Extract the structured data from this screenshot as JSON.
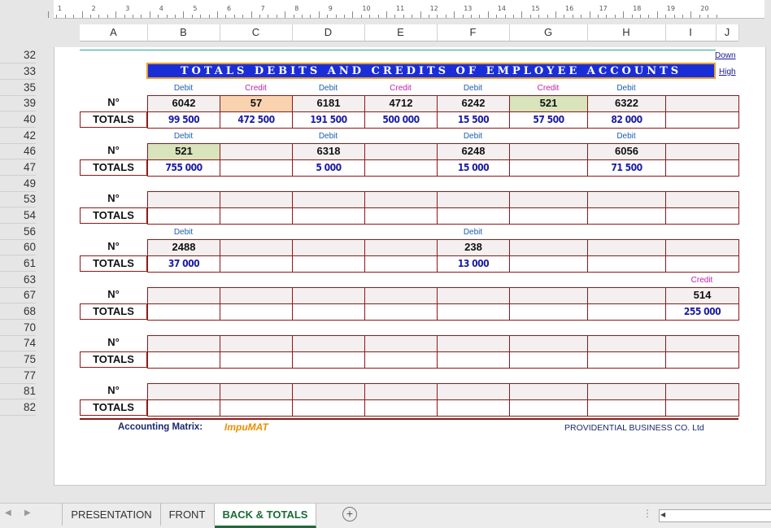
{
  "ruler": [
    "1",
    "2",
    "3",
    "4",
    "5",
    "6",
    "7",
    "8",
    "9",
    "10",
    "11",
    "12",
    "13",
    "14",
    "15",
    "16",
    "17",
    "18",
    "19",
    "20"
  ],
  "columns": [
    "A",
    "B",
    "C",
    "D",
    "E",
    "F",
    "G",
    "H",
    "I",
    "J"
  ],
  "rows": [
    "32",
    "33",
    "35",
    "39",
    "40",
    "42",
    "46",
    "47",
    "49",
    "53",
    "54",
    "56",
    "60",
    "61",
    "63",
    "67",
    "68",
    "70",
    "74",
    "75",
    "77",
    "81",
    "82"
  ],
  "title": "TOTALS DEBITS AND CREDITS OF EMPLOYEE ACCOUNTS",
  "links": {
    "down": "Down",
    "high": "High"
  },
  "labels": {
    "debit": "Debit",
    "credit": "Credit",
    "number": "N°",
    "totals": "TOTALS"
  },
  "blocks": [
    {
      "types": [
        "Debit",
        "Credit",
        "Debit",
        "Credit",
        "Debit",
        "Credit",
        "Debit",
        ""
      ],
      "numbers": [
        "6042",
        "57",
        "6181",
        "4712",
        "6242",
        "521",
        "6322",
        ""
      ],
      "totals": [
        "99 500",
        "472 500",
        "191 500",
        "500 000",
        "15 500",
        "57 500",
        "82 000",
        ""
      ],
      "highlight": [
        "",
        "orange",
        "",
        "",
        "",
        "green",
        "",
        ""
      ]
    },
    {
      "types": [
        "Debit",
        "",
        "Debit",
        "",
        "Debit",
        "",
        "Debit",
        ""
      ],
      "numbers": [
        "521",
        "",
        "6318",
        "",
        "6248",
        "",
        "6056",
        ""
      ],
      "totals": [
        "755 000",
        "",
        "5 000",
        "",
        "15 000",
        "",
        "71 500",
        ""
      ],
      "highlight": [
        "green",
        "",
        "",
        "",
        "",
        "",
        "",
        ""
      ]
    },
    {
      "types": [
        "",
        "",
        "",
        "",
        "",
        "",
        "",
        ""
      ],
      "numbers": [
        "",
        "",
        "",
        "",
        "",
        "",
        "",
        ""
      ],
      "totals": [
        "",
        "",
        "",
        "",
        "",
        "",
        "",
        ""
      ],
      "highlight": [
        "",
        "",
        "",
        "",
        "",
        "",
        "",
        ""
      ]
    },
    {
      "types": [
        "Debit",
        "",
        "",
        "",
        "Debit",
        "",
        "",
        ""
      ],
      "numbers": [
        "2488",
        "",
        "",
        "",
        "238",
        "",
        "",
        ""
      ],
      "totals": [
        "37 000",
        "",
        "",
        "",
        "13 000",
        "",
        "",
        ""
      ],
      "highlight": [
        "",
        "",
        "",
        "",
        "",
        "",
        "",
        ""
      ]
    },
    {
      "types": [
        "",
        "",
        "",
        "",
        "",
        "",
        "",
        "Credit"
      ],
      "numbers": [
        "",
        "",
        "",
        "",
        "",
        "",
        "",
        "514"
      ],
      "totals": [
        "",
        "",
        "",
        "",
        "",
        "",
        "",
        "255 000"
      ],
      "highlight": [
        "",
        "",
        "",
        "",
        "",
        "",
        "",
        ""
      ]
    },
    {
      "types": [
        "",
        "",
        "",
        "",
        "",
        "",
        "",
        ""
      ],
      "numbers": [
        "",
        "",
        "",
        "",
        "",
        "",
        "",
        ""
      ],
      "totals": [
        "",
        "",
        "",
        "",
        "",
        "",
        "",
        ""
      ],
      "highlight": [
        "",
        "",
        "",
        "",
        "",
        "",
        "",
        ""
      ]
    },
    {
      "types": [
        "",
        "",
        "",
        "",
        "",
        "",
        "",
        ""
      ],
      "numbers": [
        "",
        "",
        "",
        "",
        "",
        "",
        "",
        ""
      ],
      "totals": [
        "",
        "",
        "",
        "",
        "",
        "",
        "",
        ""
      ],
      "highlight": [
        "",
        "",
        "",
        "",
        "",
        "",
        "",
        ""
      ]
    }
  ],
  "footer": {
    "left": "Accounting Matrix:",
    "logo_a": "Impu",
    "logo_b": "MAT",
    "right": "PROVIDENTIAL BUSINESS CO. Ltd"
  },
  "tabs": {
    "items": [
      "PRESENTATION",
      "FRONT",
      "BACK & TOTALS"
    ],
    "active": "BACK & TOTALS"
  },
  "colors": {
    "title_bg": "#1a2ed8",
    "border": "#8a1a1a",
    "totals": "#1a1aa8",
    "active_tab": "#1d6b38"
  }
}
